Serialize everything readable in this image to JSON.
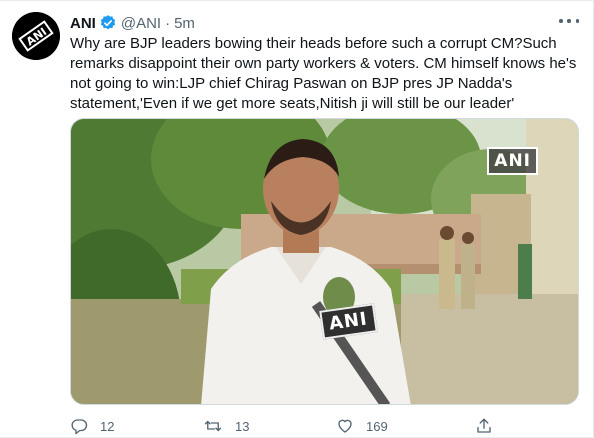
{
  "tweet": {
    "author_name": "ANI",
    "handle": "@ANI",
    "separator": "·",
    "time": "5m",
    "text_lines": [
      "Why are BJP leaders bowing their heads before such a corrupt CM?Such",
      "remarks disappoint their own party workers & voters. CM himself knows he's",
      "not going to win:LJP chief Chirag Paswan on BJP pres JP Nadda's",
      "statement,'Even if we get more seats,Nitish ji will still be our leader'"
    ],
    "media": {
      "watermark": "ANI",
      "mic_label": "ANI"
    },
    "actions": {
      "reply_count": "12",
      "retweet_count": "13",
      "like_count": "169",
      "share_count": ""
    }
  },
  "colors": {
    "verified_blue": "#1d9bf0",
    "secondary_text": "#536471",
    "primary_text": "#0f1419"
  },
  "icons": [
    "ani-logo-icon",
    "verified-badge-icon",
    "more-options-icon",
    "reply-icon",
    "retweet-icon",
    "like-icon",
    "share-icon"
  ]
}
